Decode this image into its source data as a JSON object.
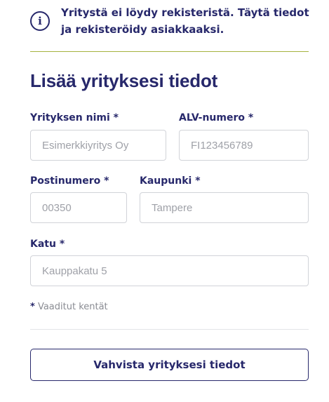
{
  "notice": {
    "icon": "info-icon",
    "icon_glyph": "i",
    "line1": "Yritystä ei löydy rekisteristä. Täytä tiedot",
    "line2": "ja rekisteröidy asiakkaaksi."
  },
  "form": {
    "title": "Lisää yrityksesi tiedot",
    "fields": {
      "company_name": {
        "label": "Yrityksen nimi *",
        "value": "",
        "placeholder": "Esimerkkiyritys Oy"
      },
      "vat_number": {
        "label": "ALV-numero *",
        "value": "",
        "placeholder": "FI123456789"
      },
      "postal_code": {
        "label": "Postinumero *",
        "value": "",
        "placeholder": "00350"
      },
      "city": {
        "label": "Kaupunki *",
        "value": "",
        "placeholder": "Tampere"
      },
      "street": {
        "label": "Katu *",
        "value": "",
        "placeholder": "Kauppakatu 5"
      }
    },
    "required_note": {
      "star": "*",
      "text": " Vaaditut kentät"
    },
    "submit_label": "Vahvista yrityksesi tiedot"
  },
  "colors": {
    "primary": "#27286b",
    "accent_divider": "#a5b23f",
    "border": "#d1d3d8",
    "muted_text": "#8a8c93"
  }
}
